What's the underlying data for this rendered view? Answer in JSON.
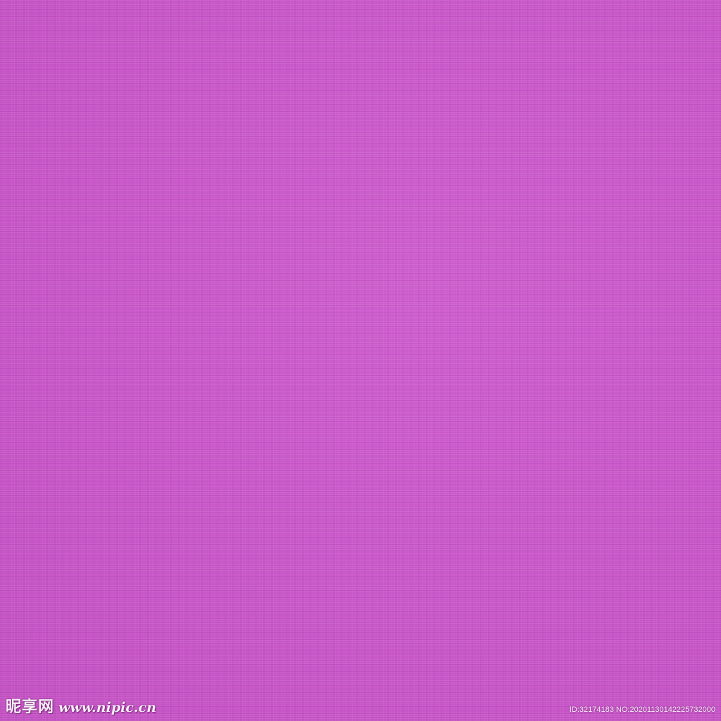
{
  "colors": {
    "fabric": "#cc55cc"
  },
  "watermark": {
    "logo_text": "昵享网",
    "url": "www.nipic.cn",
    "id_line": "ID:32174183 NO:20201130142225732000"
  }
}
